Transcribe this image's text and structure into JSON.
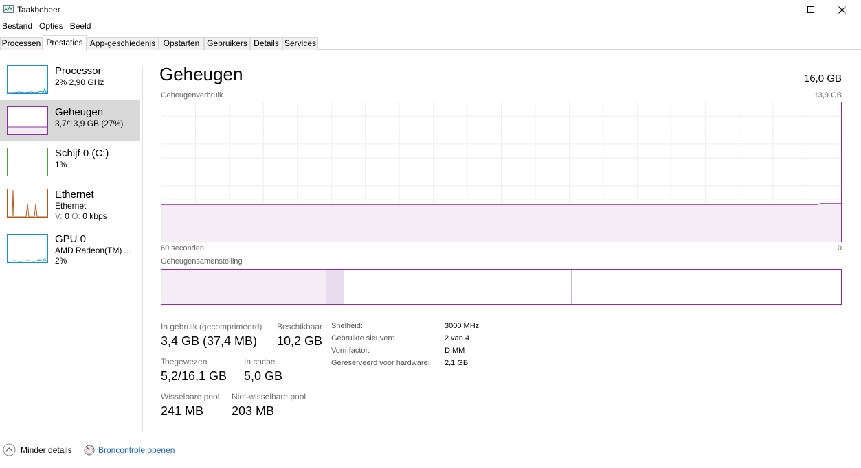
{
  "window": {
    "title": "Taakbeheer",
    "icon": "task-manager-icon",
    "controls": [
      "minimize-icon",
      "maximize-icon",
      "close-icon"
    ]
  },
  "menu": [
    "Bestand",
    "Opties",
    "Beeld"
  ],
  "tabs": [
    {
      "label": "Processen",
      "active": false
    },
    {
      "label": "Prestaties",
      "active": true
    },
    {
      "label": "App-geschiedenis",
      "active": false
    },
    {
      "label": "Opstarten",
      "active": false
    },
    {
      "label": "Gebruikers",
      "active": false
    },
    {
      "label": "Details",
      "active": false
    },
    {
      "label": "Services",
      "active": false
    }
  ],
  "sidebar": [
    {
      "title": "Processor",
      "sub1": "2% 2,90 GHz",
      "color": "#1a8fc8",
      "active": false
    },
    {
      "title": "Geheugen",
      "sub1": "3,7/13,9 GB (27%)",
      "color": "#8b2fa0",
      "active": true
    },
    {
      "title": "Schijf 0 (C:)",
      "sub1": "1%",
      "color": "#4aa63a",
      "active": false
    },
    {
      "title": "Ethernet",
      "sub1": "Ethernet",
      "sub2_s_label": "V:",
      "sub2_s_value": "0",
      "sub2_r_label": "O:",
      "sub2_r_value": "0 kbps",
      "color": "#b3591b",
      "active": false
    },
    {
      "title": "GPU 0",
      "sub1": "AMD Radeon(TM) ...",
      "sub2": "2%",
      "color": "#1a8fc8",
      "active": false
    }
  ],
  "main": {
    "title": "Geheugen",
    "total": "16,0 GB",
    "usage_label": "Geheugenverbruik",
    "usage_max": "13,9 GB",
    "time_left": "60 seconden",
    "time_right": "0",
    "composition_label": "Geheugensamenstelling",
    "accent": "#8b2fa0",
    "usage_fraction": 0.265
  },
  "stats": {
    "in_use_label": "In gebruik (gecomprimeerd)",
    "in_use_value": "3,4 GB (37,4 MB)",
    "available_label": "Beschikbaar",
    "available_value": "10,2 GB",
    "committed_label": "Toegewezen",
    "committed_value": "5,2/16,1 GB",
    "cached_label": "In cache",
    "cached_value": "5,0 GB",
    "paged_label": "Wisselbare pool",
    "paged_value": "241 MB",
    "nonpaged_label": "Niet-wisselbare pool",
    "nonpaged_value": "203 MB"
  },
  "specs": [
    {
      "label": "Snelheid:",
      "value": "3000 MHz"
    },
    {
      "label": "Gebruikte sleuven:",
      "value": "2 van 4"
    },
    {
      "label": "Vormfactor:",
      "value": "DIMM"
    },
    {
      "label": "Gereserveerd voor hardware:",
      "value": "2,1 GB"
    }
  ],
  "footer": {
    "less_details": "Minder details",
    "resource_monitor": "Broncontrole openen"
  }
}
